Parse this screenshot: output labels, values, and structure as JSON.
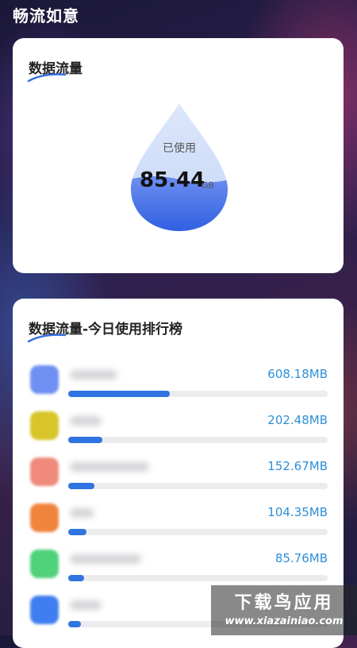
{
  "header": {
    "title": "畅流如意"
  },
  "usage_card": {
    "title": "数据流量",
    "label": "已使用",
    "value": "85.44",
    "unit": "GB",
    "fill_fraction": 0.4
  },
  "ranking_card": {
    "title": "数据流量-今日使用排行榜",
    "items": [
      {
        "usage": "608.18MB",
        "share": 0.39,
        "icon_color": "#6f8ff2"
      },
      {
        "usage": "202.48MB",
        "share": 0.13,
        "icon_color": "#d8c52a"
      },
      {
        "usage": "152.67MB",
        "share": 0.1,
        "icon_color": "#f08a7a"
      },
      {
        "usage": "104.35MB",
        "share": 0.07,
        "icon_color": "#f0843c"
      },
      {
        "usage": "85.76MB",
        "share": 0.06,
        "icon_color": "#4fd27a"
      },
      {
        "usage": "",
        "share": 0.05,
        "icon_color": "#3f7ef0"
      }
    ]
  },
  "watermark": {
    "main": "下载鸟应用",
    "sub": "www.xiazainiao.com"
  }
}
